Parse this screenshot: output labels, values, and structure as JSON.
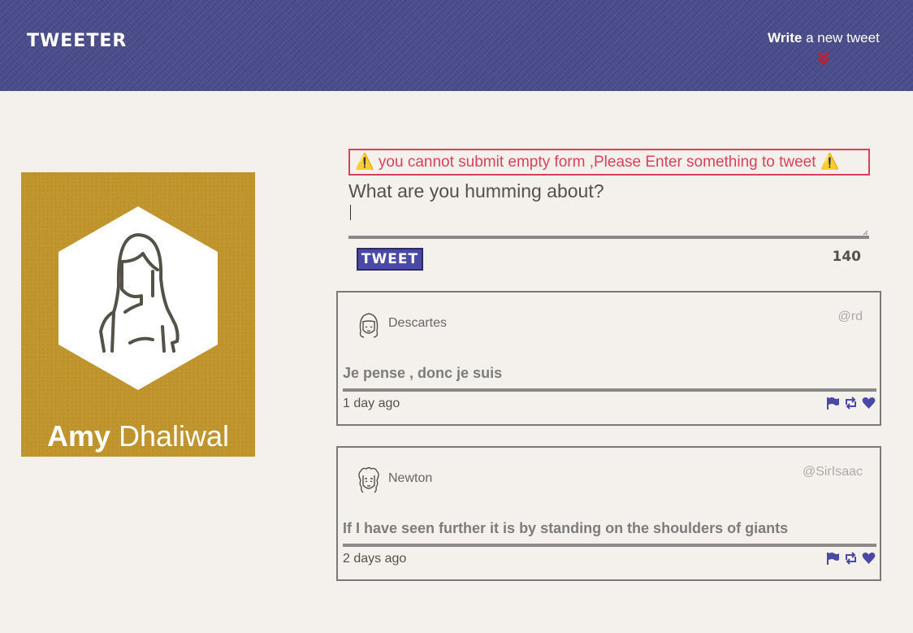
{
  "nav": {
    "brand": "TWEETER",
    "compose_prefix": "Write",
    "compose_suffix": " a new tweet",
    "accent_color": "#d21a22"
  },
  "profile": {
    "first_name": "Amy",
    "last_name": " Dhaliwal"
  },
  "compose": {
    "error": "⚠️ you cannot submit empty form ,Please Enter something to tweet ⚠️",
    "label": "What are you humming about?",
    "value": "",
    "button_label": "TWEET",
    "counter": "140"
  },
  "tweets": [
    {
      "name": "Descartes",
      "handle": "@rd",
      "content": "Je pense , donc je suis",
      "time": "1 day ago"
    },
    {
      "name": "Newton",
      "handle": "@SirIsaac",
      "content": "If I have seen further it is by standing on the shoulders of giants",
      "time": "2 days ago"
    }
  ],
  "colors": {
    "nav": "#4a4c8c",
    "profile": "#c1952d",
    "error": "#d9405e",
    "action_icons": "#4a4aa6"
  },
  "icons": [
    "chevron-double-down-icon",
    "flag-icon",
    "retweet-icon",
    "heart-icon"
  ]
}
